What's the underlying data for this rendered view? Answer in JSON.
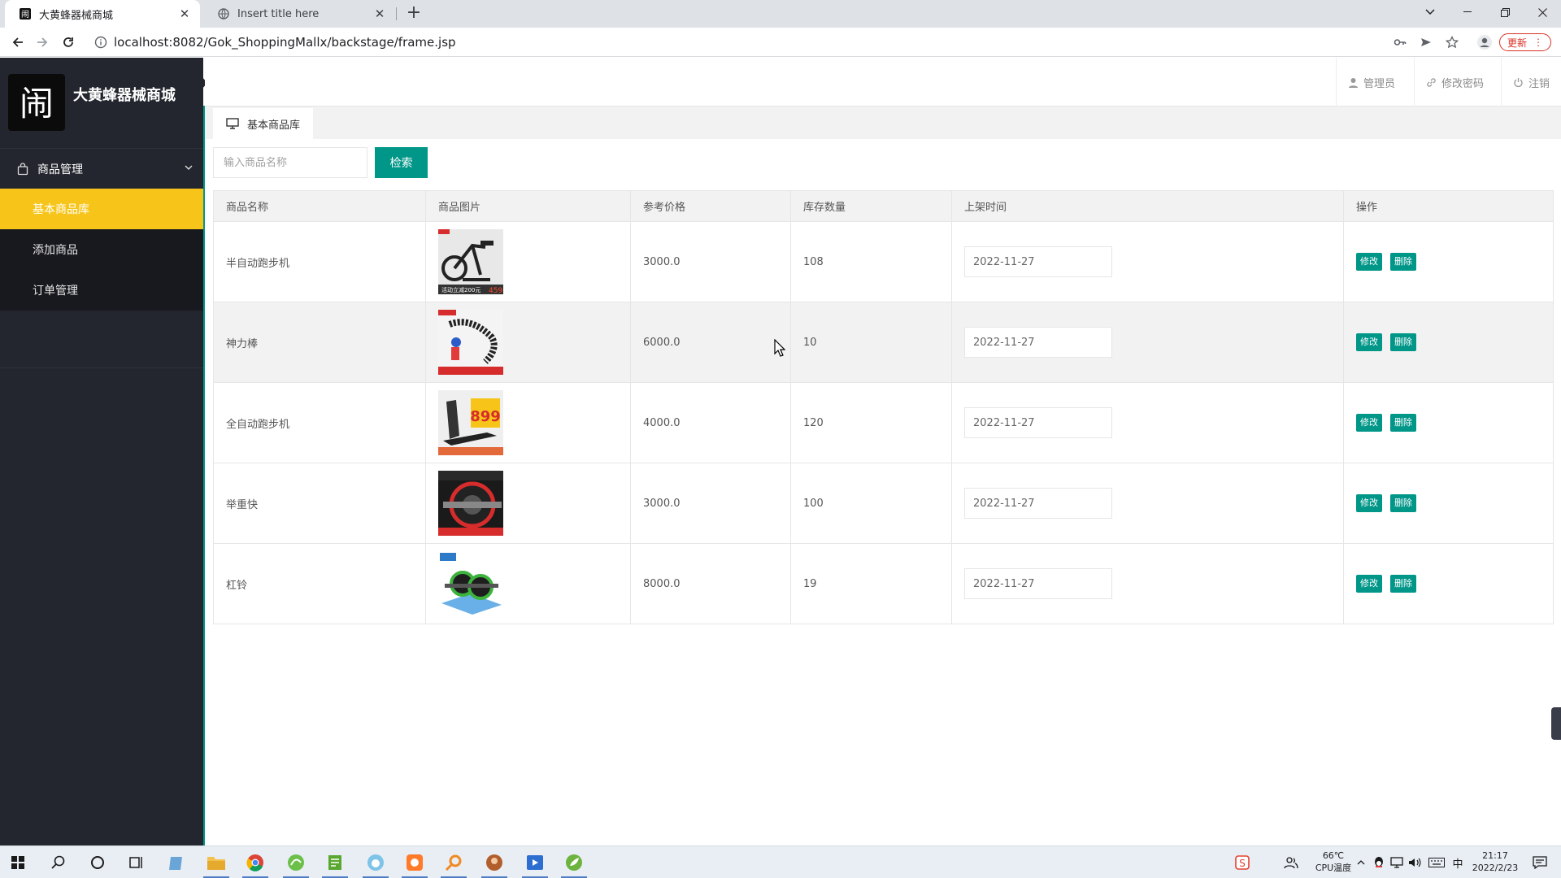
{
  "browser": {
    "tabs": [
      {
        "title": "大黄蜂器械商城",
        "active": true
      },
      {
        "title": "Insert title here",
        "active": false
      }
    ],
    "url": "localhost:8082/Gok_ShoppingMallx/backstage/frame.jsp",
    "update_label": "更新"
  },
  "app": {
    "brand": "大黄蜂器械商城",
    "logo_glyph": "闹",
    "sidebar": {
      "group_label": "商品管理",
      "items": [
        {
          "label": "基本商品库",
          "active": true
        },
        {
          "label": "添加商品",
          "active": false
        },
        {
          "label": "订单管理",
          "active": false
        }
      ]
    },
    "header": {
      "admin": "管理员",
      "change_password": "修改密码",
      "logout": "注销"
    },
    "page_tab": "基本商品库",
    "search": {
      "placeholder": "输入商品名称",
      "button": "检索"
    },
    "table": {
      "columns": [
        "商品名称",
        "商品图片",
        "参考价格",
        "库存数量",
        "上架时间",
        "操作"
      ],
      "rows": [
        {
          "name": "半自动跑步机",
          "image": "spin-bike",
          "price": "3000.0",
          "stock": "108",
          "date": "2022-11-27"
        },
        {
          "name": "神力棒",
          "image": "power-twister",
          "price": "6000.0",
          "stock": "10",
          "date": "2022-11-27"
        },
        {
          "name": "全自动跑步机",
          "image": "treadmill",
          "price": "4000.0",
          "stock": "120",
          "date": "2022-11-27"
        },
        {
          "name": "举重快",
          "image": "weight-plate",
          "price": "3000.0",
          "stock": "100",
          "date": "2022-11-27"
        },
        {
          "name": "杠铃",
          "image": "ab-roller",
          "price": "8000.0",
          "stock": "19",
          "date": "2022-11-27"
        }
      ],
      "edit_label": "修改",
      "delete_label": "删除"
    }
  },
  "taskbar": {
    "temp": "66℃",
    "temp_label": "CPU温度",
    "time": "21:17",
    "date": "2022/2/23",
    "ime": "中"
  },
  "colors": {
    "accent": "#009688",
    "sidebar": "#23262e",
    "active_item": "#f7c51a"
  }
}
